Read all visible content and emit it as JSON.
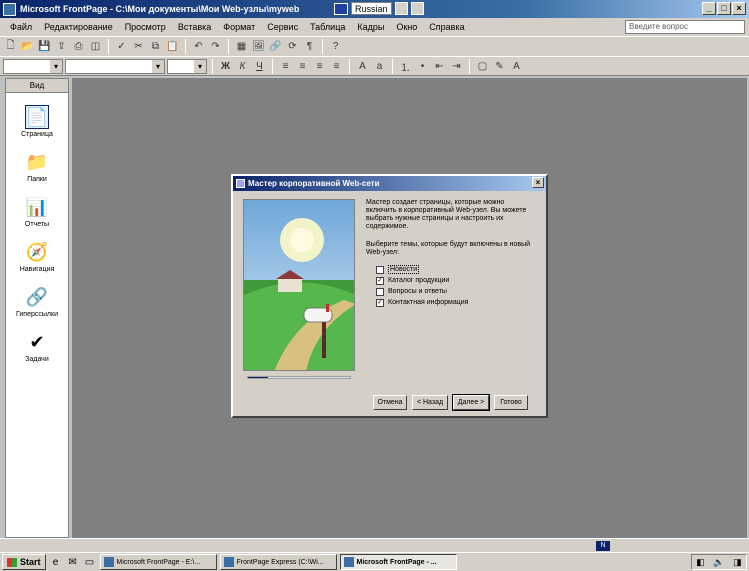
{
  "window": {
    "title": "Microsoft FrontPage - C:\\Мои документы\\Мои Web-узлы\\myweb",
    "language": "Russian",
    "controls": [
      "_",
      "□",
      "×"
    ]
  },
  "menubar": {
    "items": [
      "Файл",
      "Редактирование",
      "Просмотр",
      "Вставка",
      "Формат",
      "Сервис",
      "Таблица",
      "Кадры",
      "Окно",
      "Справка"
    ],
    "help_placeholder": "Введите вопрос"
  },
  "views": {
    "header": "Вид",
    "items": [
      {
        "label": "Страница",
        "icon": "page-view-icon"
      },
      {
        "label": "Папки",
        "icon": "folders-icon"
      },
      {
        "label": "Отчеты",
        "icon": "reports-icon"
      },
      {
        "label": "Навигация",
        "icon": "navigation-icon"
      },
      {
        "label": "Гиперссылки",
        "icon": "hyperlinks-icon"
      },
      {
        "label": "Задачи",
        "icon": "tasks-icon"
      }
    ]
  },
  "dialog": {
    "title": "Мастер корпоративной Web-сети",
    "intro": "Мастер создает страницы, которые можно включить в корпоративный Web-узел. Вы можете выбрать нужные страницы и настроить их содержимое.",
    "prompt": "Выберите темы, которые будут включены в новый Web-узел:",
    "options": [
      {
        "label": "Новости",
        "checked": false
      },
      {
        "label": "Каталог продукции",
        "checked": true
      },
      {
        "label": "Вопросы и ответы",
        "checked": false
      },
      {
        "label": "Контактная информация",
        "checked": true
      }
    ],
    "progress": 0.2,
    "buttons": {
      "cancel": "Отмена",
      "back": "< Назад",
      "next": "Далее >",
      "finish": "Готово"
    }
  },
  "statusbar": {
    "badge": "N"
  },
  "taskbar": {
    "start": "Start",
    "tasks": [
      {
        "label": "Microsoft FrontPage - E:\\...",
        "active": false
      },
      {
        "label": "FrontPage Express (C:\\Wi...",
        "active": false
      },
      {
        "label": "Microsoft FrontPage - ...",
        "active": true
      }
    ]
  }
}
